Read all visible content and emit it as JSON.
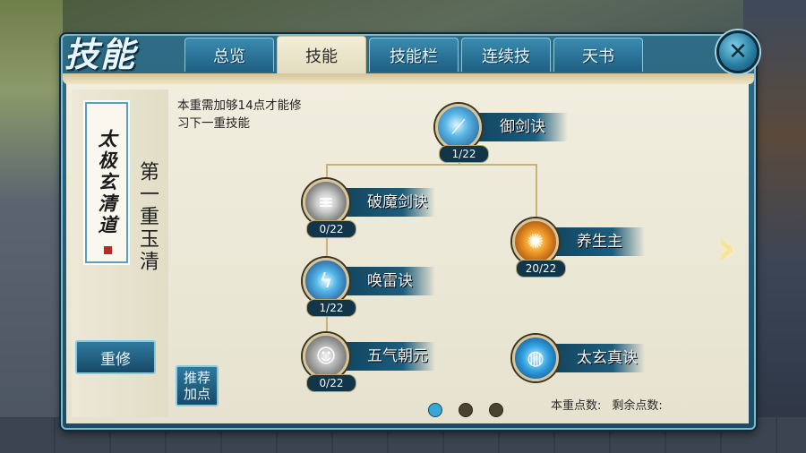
{
  "window": {
    "title": "技能",
    "close_icon": "close-icon"
  },
  "tabs": [
    {
      "label": "总览",
      "active": false
    },
    {
      "label": "技能",
      "active": true
    },
    {
      "label": "技能栏",
      "active": false
    },
    {
      "label": "连续技",
      "active": false
    },
    {
      "label": "天书",
      "active": false
    }
  ],
  "sect": {
    "name": "太极玄清道",
    "tier_label": "第一重玉清"
  },
  "hint_text": "本重需加够14点才能修习下一重技能",
  "buttons": {
    "rebuild": "重修",
    "recommend_line1": "推荐",
    "recommend_line2": "加点"
  },
  "skills": [
    {
      "name": "御剑诀",
      "points": "1/22",
      "icon": "sword-icon"
    },
    {
      "name": "破魔剑诀",
      "points": "0/22",
      "icon": "demon-breaker-icon"
    },
    {
      "name": "养生主",
      "points": "20/22",
      "icon": "life-icon"
    },
    {
      "name": "唤雷诀",
      "points": "1/22",
      "icon": "thunder-icon"
    },
    {
      "name": "五气朝元",
      "points": "0/22",
      "icon": "five-qi-icon"
    },
    {
      "name": "太玄真诀",
      "points": "",
      "icon": "taixuan-icon"
    }
  ],
  "pagination": {
    "pages": 3,
    "current": 1
  },
  "footer": {
    "tier_points_label": "本重点数:",
    "remaining_points_label": "剩余点数:"
  },
  "colors": {
    "frame_blue": "#1d4d66",
    "parchment": "#f1eedf",
    "accent_gold": "#d6c79a"
  }
}
